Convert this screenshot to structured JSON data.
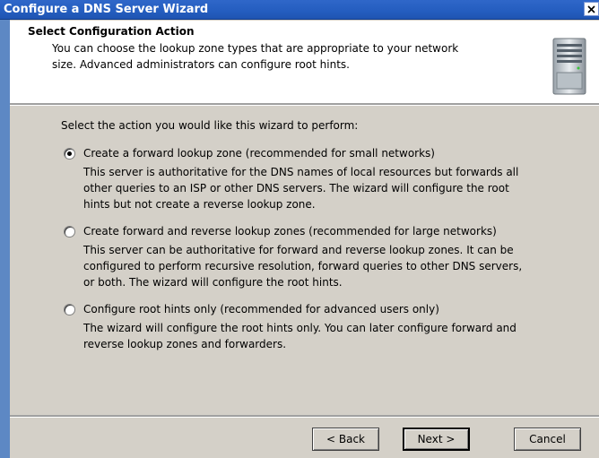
{
  "window": {
    "title": "Configure a DNS Server Wizard"
  },
  "header": {
    "title": "Select Configuration Action",
    "subtitle_line1": "You can choose the lookup zone types that are appropriate to your network",
    "subtitle_line2": "size. Advanced administrators can configure root hints."
  },
  "prompt": "Select the action you would like this wizard to perform:",
  "options": [
    {
      "label": "Create a forward lookup zone (recommended for small networks)",
      "selected": true,
      "desc": [
        "This server is authoritative for the DNS names of local resources but forwards all",
        "other queries to an ISP or other DNS servers. The wizard will configure the root",
        "hints but not create a reverse lookup zone."
      ]
    },
    {
      "label": "Create forward and reverse lookup zones (recommended for large networks)",
      "selected": false,
      "desc": [
        "This server can be authoritative for forward and reverse lookup zones. It can be",
        "configured to perform recursive resolution, forward queries to other DNS servers,",
        "or both. The wizard will configure the root hints."
      ]
    },
    {
      "label": "Configure root hints only (recommended for advanced users only)",
      "selected": false,
      "desc": [
        "The wizard will configure the root hints only. You can later configure forward and",
        "reverse lookup zones and forwarders."
      ]
    }
  ],
  "buttons": {
    "back": "< Back",
    "next": "Next >",
    "cancel": "Cancel"
  }
}
